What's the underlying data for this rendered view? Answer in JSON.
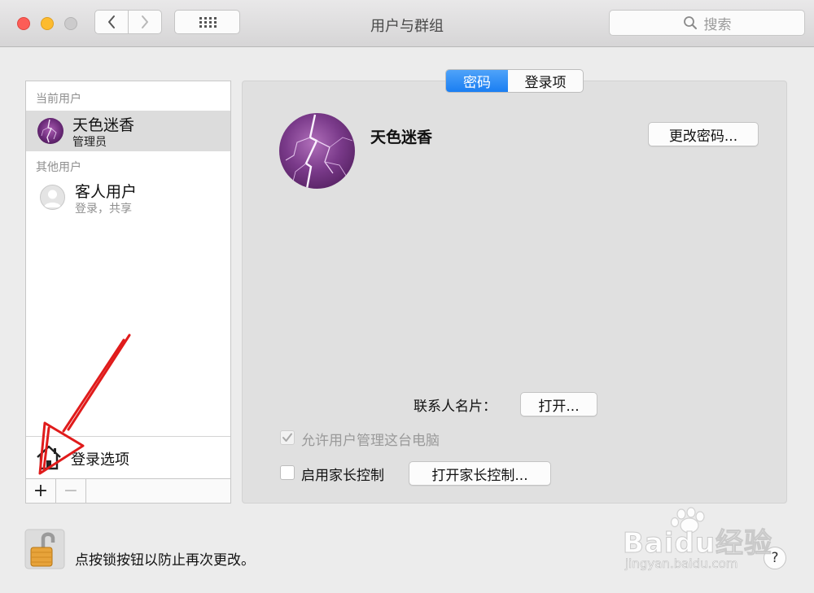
{
  "window": {
    "title": "用户与群组",
    "search_placeholder": "搜索"
  },
  "sidebar": {
    "current_section": "当前用户",
    "current_user": {
      "name": "天色迷香",
      "role": "管理员"
    },
    "other_section": "其他用户",
    "guest_user": {
      "name": "客人用户",
      "detail": "登录，共享"
    },
    "login_options": "登录选项",
    "add_label": "+",
    "remove_label": "−"
  },
  "tabs": [
    {
      "label": "密码",
      "selected": true
    },
    {
      "label": "登录项",
      "selected": false
    }
  ],
  "main": {
    "user_fullname": "天色迷香",
    "change_password_button": "更改密码...",
    "contact_card_label": "联系人名片：",
    "contact_card_button": "打开...",
    "allow_admin_label": "允许用户管理这台电脑",
    "allow_admin_checked": true,
    "allow_admin_enabled": false,
    "parental_label": "启用家长控制",
    "parental_checked": false,
    "parental_button": "打开家长控制..."
  },
  "footer": {
    "lock_label": "点按锁按钮以防止再次更改。",
    "help_label": "?"
  },
  "watermark": {
    "brand": "Baidu经验",
    "url": "jingyan.baidu.com"
  },
  "colors": {
    "accent_tab": "#1a7ef2",
    "arrow_annotation": "#e01b1b",
    "close": "#fc5d57",
    "minimize": "#fdbb2f"
  }
}
